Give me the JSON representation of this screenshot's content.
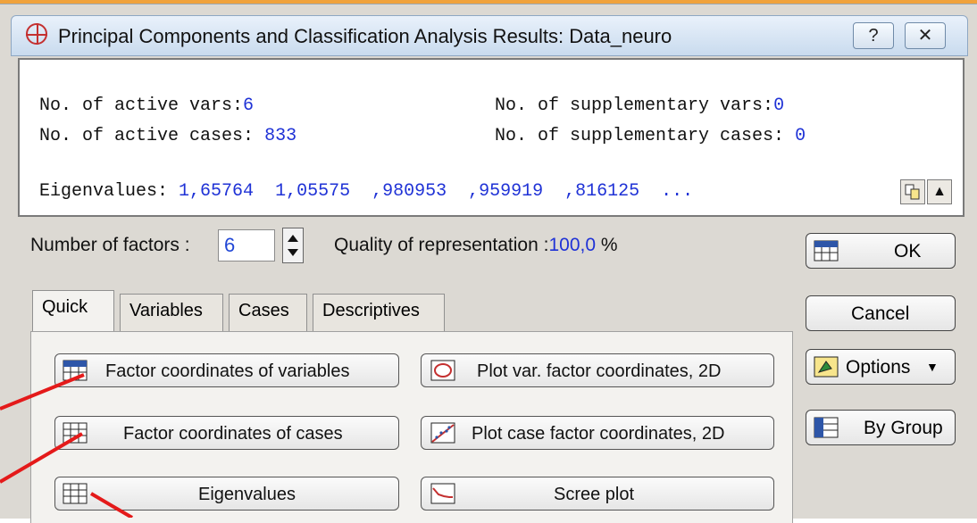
{
  "window": {
    "title": "Principal Components and Classification Analysis Results: Data_neuro",
    "help_label": "?",
    "close_label": "✕"
  },
  "results": {
    "active_vars_label": "No. of active vars:",
    "active_vars_value": "6",
    "supp_vars_label": "No. of supplementary vars:",
    "supp_vars_value": "0",
    "active_cases_label": "No. of active cases:",
    "active_cases_value": "833",
    "supp_cases_label": "No. of supplementary cases:",
    "supp_cases_value": "0",
    "eigen_label": "Eigenvalues:",
    "eigenvalues": "1,65764  1,05575  ,980953  ,959919  ,816125  ..."
  },
  "controls": {
    "num_factors_label": "Number of factors :",
    "num_factors_value": "6",
    "quality_label": "Quality of representation :",
    "quality_value": "100,0",
    "quality_unit": "%"
  },
  "tabs": [
    "Quick",
    "Variables",
    "Cases",
    "Descriptives"
  ],
  "buttons": {
    "factor_coords_vars": "Factor coordinates of variables",
    "plot_var_coords": "Plot var. factor coordinates, 2D",
    "factor_coords_cases": "Factor coordinates of cases",
    "plot_case_coords": "Plot case factor coordinates, 2D",
    "eigenvalues": "Eigenvalues",
    "scree_plot": "Scree plot"
  },
  "side": {
    "ok": "OK",
    "cancel": "Cancel",
    "options": "Options",
    "by_group": "By Group"
  },
  "icons": {
    "app": "pca-crosshair-icon",
    "copy": "copy-icon",
    "expand": "expand-up-icon",
    "summary": "summary-table-icon",
    "spreadsheet": "spreadsheet-icon",
    "scatter_var": "scatter-var-icon",
    "scatter_case": "scatter-case-icon",
    "scree": "scree-plot-icon",
    "options": "options-icon",
    "bygroup": "by-group-icon"
  },
  "colors": {
    "value_blue": "#1f32d6",
    "annotation_red": "#e41a1a"
  }
}
